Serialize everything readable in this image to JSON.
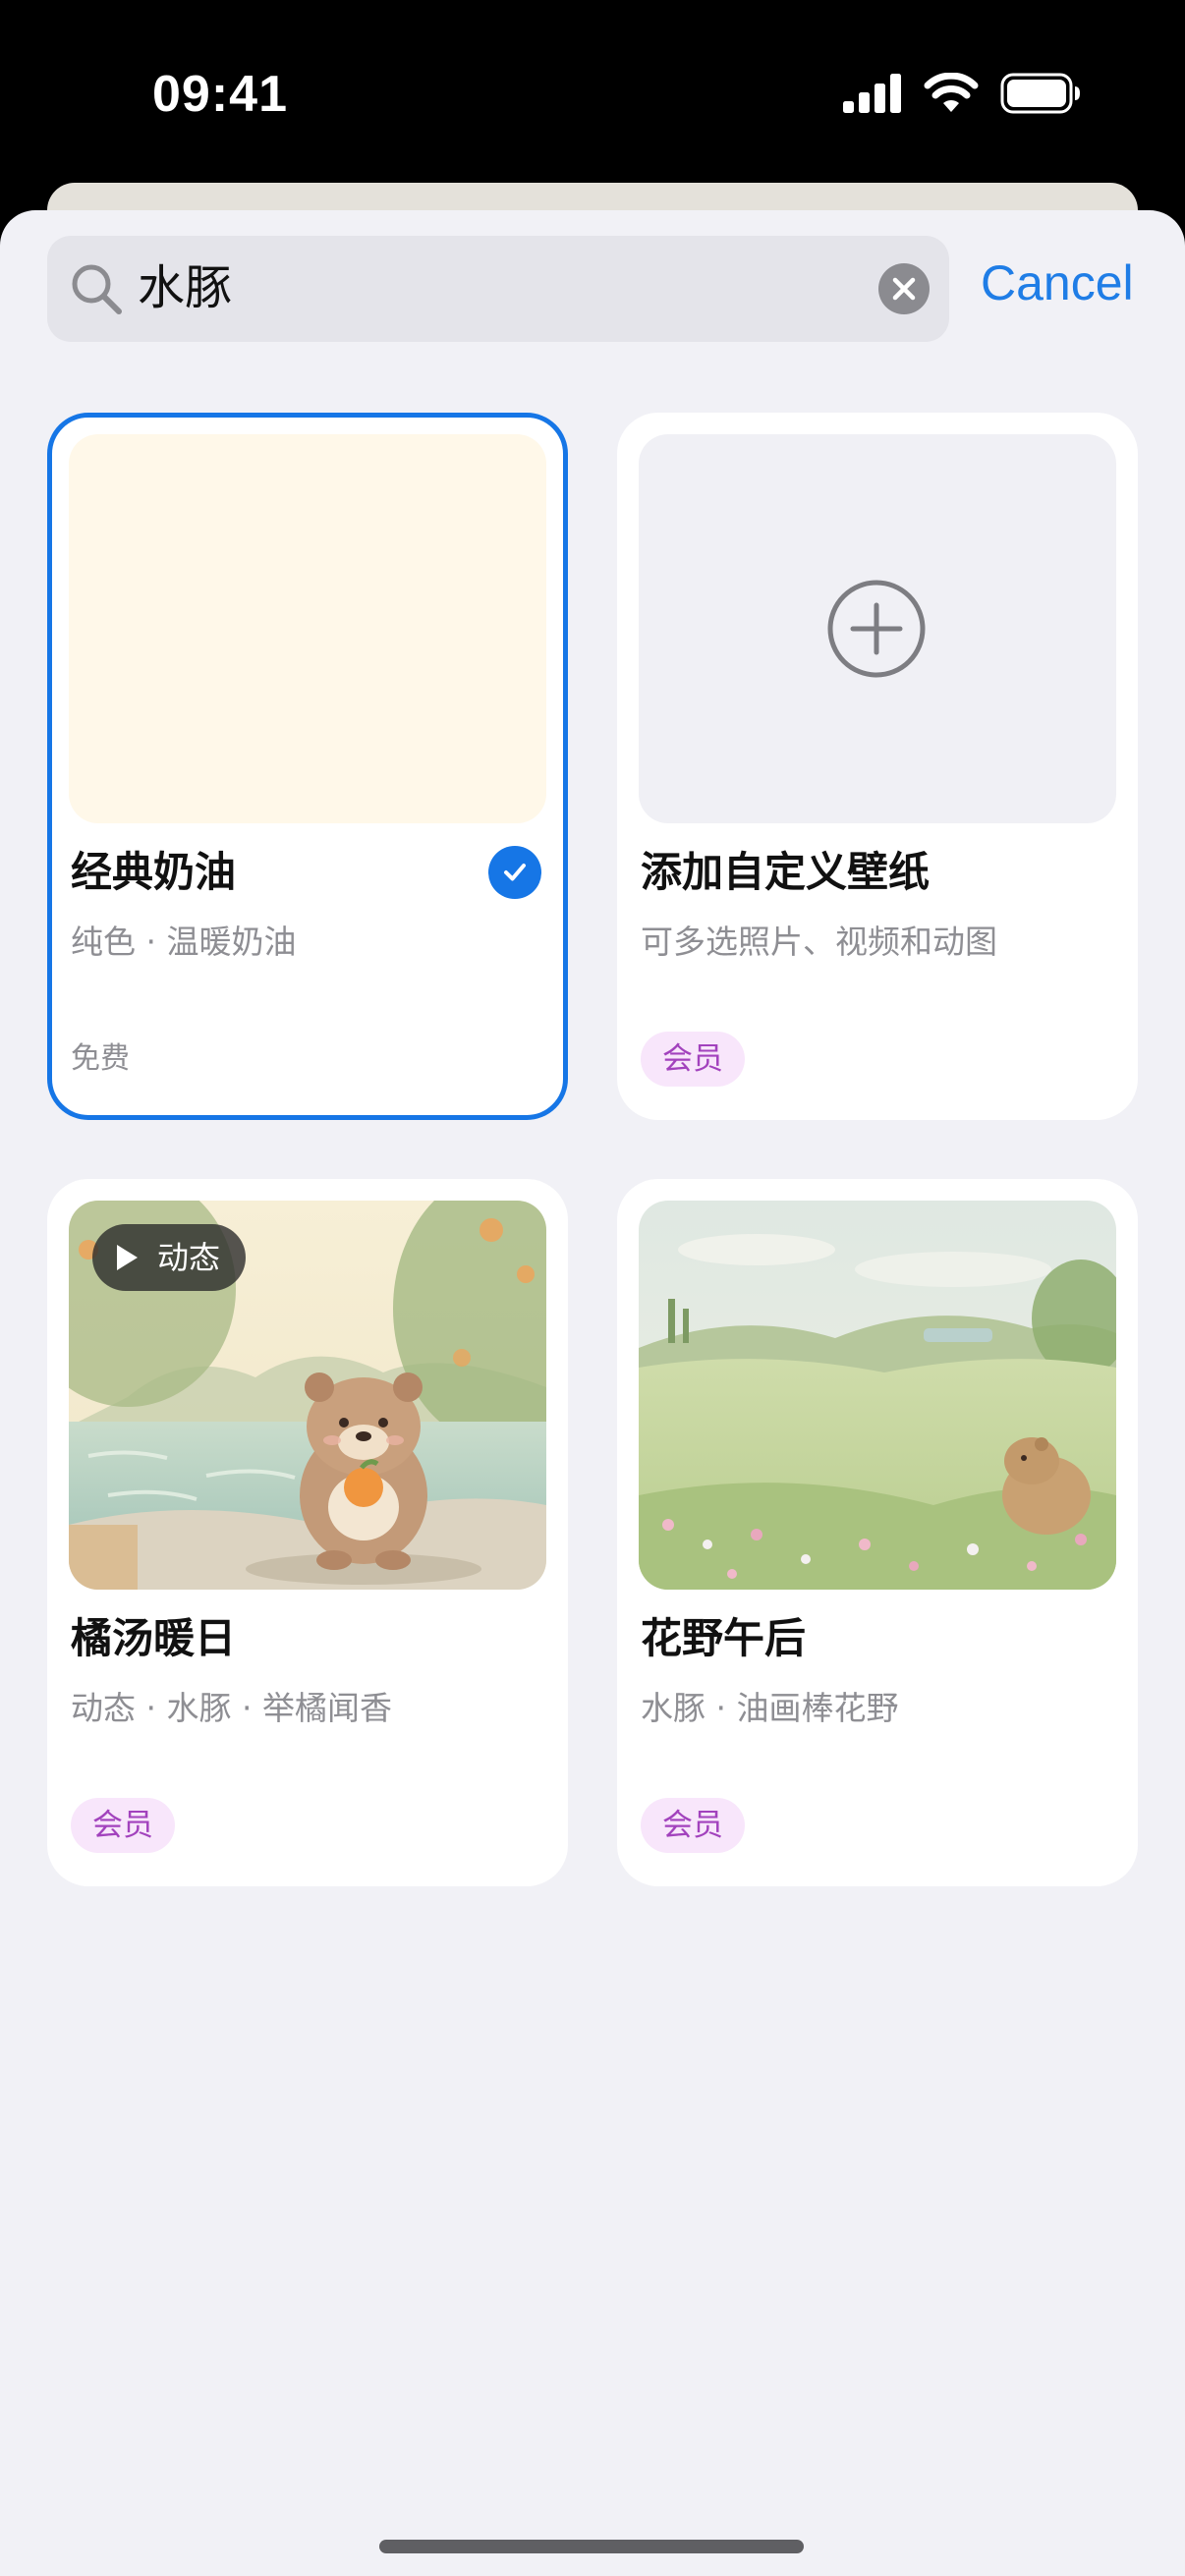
{
  "status": {
    "time": "09:41"
  },
  "search": {
    "query": "水豚",
    "cancel_label": "Cancel"
  },
  "cards": [
    {
      "title": "经典奶油",
      "subtitle": "纯色 · 温暖奶油",
      "price": "免费",
      "selected": true
    },
    {
      "title": "添加自定义壁纸",
      "subtitle": "可多选照片、视频和动图",
      "badge": "会员"
    },
    {
      "title": "橘汤暖日",
      "subtitle": "动态 · 水豚 · 举橘闻香",
      "badge": "会员",
      "tag": "动态"
    },
    {
      "title": "花野午后",
      "subtitle": "水豚 · 油画棒花野",
      "badge": "会员"
    }
  ],
  "colors": {
    "accent": "#1676e6",
    "badge_bg": "#f8e6fb",
    "badge_text": "#a242bd",
    "cream": "#fff8e9"
  }
}
